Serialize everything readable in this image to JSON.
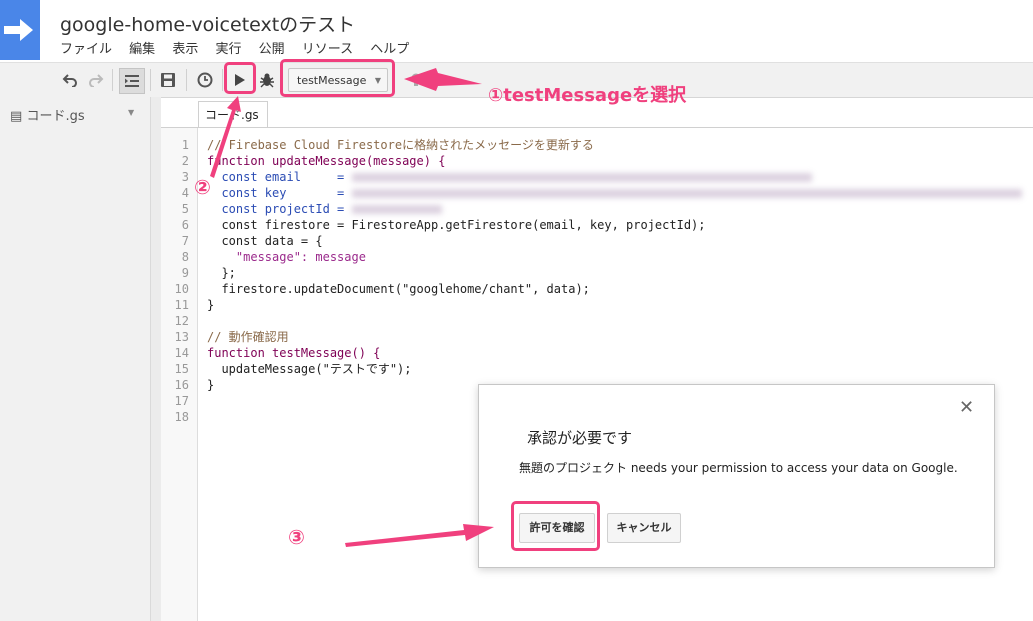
{
  "header": {
    "title": "google-home-voicetextのテスト",
    "menu": [
      "ファイル",
      "編集",
      "表示",
      "実行",
      "公開",
      "リソース",
      "ヘルプ"
    ]
  },
  "toolbar": {
    "function_select": "testMessage",
    "icons": [
      "undo-icon",
      "redo-icon",
      "indent-icon",
      "save-icon",
      "clock-icon",
      "run-icon",
      "debug-icon"
    ]
  },
  "sidebar": {
    "file": "コード.gs"
  },
  "editor": {
    "tab": "コード.gs",
    "lines": [
      {
        "n": "1",
        "t": "// Firebase Cloud Firestoreに格納されたメッセージを更新する"
      },
      {
        "n": "2",
        "t": "function updateMessage(message) {"
      },
      {
        "n": "3",
        "t": "  const email     = "
      },
      {
        "n": "4",
        "t": "  const key       = "
      },
      {
        "n": "5",
        "t": "  const projectId = "
      },
      {
        "n": "6",
        "t": "  const firestore = FirestoreApp.getFirestore(email, key, projectId);"
      },
      {
        "n": "7",
        "t": "  const data = {"
      },
      {
        "n": "8",
        "t": "    \"message\": message"
      },
      {
        "n": "9",
        "t": "  };"
      },
      {
        "n": "10",
        "t": "  firestore.updateDocument(\"googlehome/chant\", data);"
      },
      {
        "n": "11",
        "t": "}"
      },
      {
        "n": "12",
        "t": ""
      },
      {
        "n": "13",
        "t": "// 動作確認用"
      },
      {
        "n": "14",
        "t": "function testMessage() {"
      },
      {
        "n": "15",
        "t": "  updateMessage(\"テストです\");"
      },
      {
        "n": "16",
        "t": "}"
      },
      {
        "n": "17",
        "t": ""
      },
      {
        "n": "18",
        "t": ""
      }
    ]
  },
  "dialog": {
    "title": "承認が必要です",
    "message": "無題のプロジェクト needs your permission to access your data on Google.",
    "allow_label": "許可を確認",
    "cancel_label": "キャンセル",
    "close": "✕"
  },
  "annotations": {
    "step1": "①testMessageを選択",
    "step2": "②",
    "step3": "③",
    "color": "#f0407e"
  }
}
